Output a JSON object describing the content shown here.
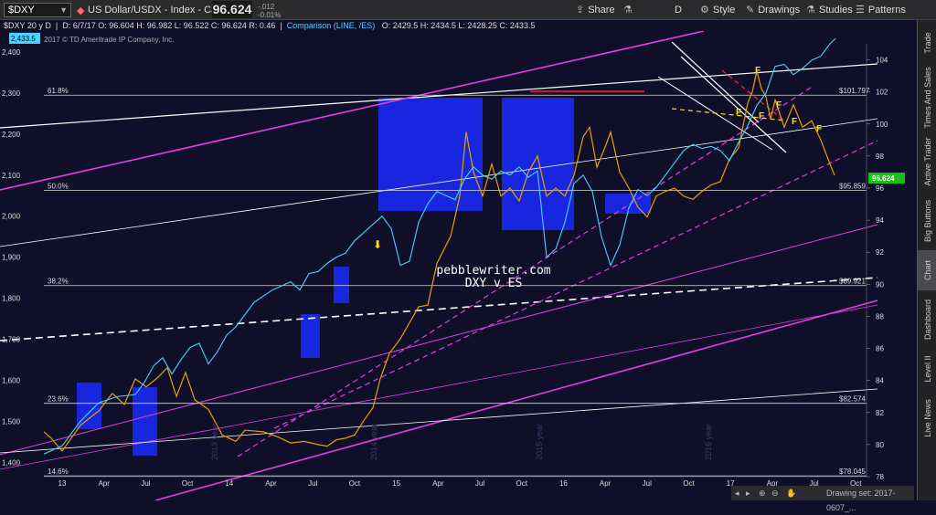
{
  "header": {
    "symbol": "$DXY",
    "description": "US Dollar/USDX - Index - Cash",
    "last_price": "96.624",
    "change": "-.012",
    "change_pct": "-0.01%",
    "buttons": [
      {
        "label": "Share",
        "icon": "share-icon"
      },
      {
        "label": "",
        "icon": "flask-icon"
      },
      {
        "label": "D",
        "icon": "period-icon"
      },
      {
        "label": "Style",
        "icon": "style-icon"
      },
      {
        "label": "Drawings",
        "icon": "pencil-icon"
      },
      {
        "label": "",
        "icon": "flask-icon"
      },
      {
        "label": "Studies",
        "icon": "flask-icon"
      },
      {
        "label": "Patterns",
        "icon": "patterns-icon"
      }
    ]
  },
  "info": {
    "title": "$DXY 20 y D",
    "ohlc": "D: 6/7/17   O: 96.604   H: 96.982   L: 96.522   C: 96.624   R: 0.46",
    "comparison": "Comparison (LINE, /ES)",
    "cmp_ohlc": "O: 2429.5   H: 2434.5   L: 2428.25   C: 2433.5",
    "copyright": "2017 © TD Ameritrade IP Company, Inc."
  },
  "side_tabs": [
    "Trade",
    "Times And Sales",
    "Active Trader",
    "Big Buttons",
    "Chart",
    "Dashboard",
    "Level II",
    "Live News"
  ],
  "active_side_tab": "Chart",
  "status": {
    "drawing_set": "Drawing set: 2017-0607_..."
  },
  "chart_data": {
    "type": "line",
    "x_ticks": [
      "13",
      "Apr",
      "Jul",
      "Oct",
      "14",
      "Apr",
      "Jul",
      "Oct",
      "15",
      "Apr",
      "Jul",
      "Oct",
      "16",
      "Apr",
      "Jul",
      "Oct",
      "17",
      "Apr",
      "Jul",
      "Oct"
    ],
    "right_axis": {
      "ticks": [
        78,
        80,
        82,
        84,
        86,
        88,
        90,
        92,
        94,
        96,
        98,
        100,
        102,
        104
      ],
      "range": [
        78,
        105
      ]
    },
    "left_axis": {
      "ticks": [
        "1,400",
        "1,500",
        "1,600",
        "1,700",
        "1,800",
        "1,900",
        "2,000",
        "2,100",
        "2,200",
        "2,300",
        "2,400"
      ],
      "range": [
        1365,
        2420
      ]
    },
    "price_label": "96.624",
    "compare_label": "2,433.5",
    "fib_levels": [
      {
        "pct": "61.8%",
        "value": "$101.797",
        "level": 101.797
      },
      {
        "pct": "50.0%",
        "value": "$95.859",
        "level": 95.859
      },
      {
        "pct": "38.2%",
        "value": "$89.921",
        "level": 89.921
      },
      {
        "pct": "23.6%",
        "value": "$82.574",
        "level": 82.574
      },
      {
        "pct": "14.6%",
        "value": "$78.045",
        "level": 78.045
      }
    ],
    "annotations": [
      "pebblewriter.com",
      "DXY v ES"
    ],
    "year_labels": [
      "2013 year",
      "2014 year",
      "2015 year",
      "2016 year"
    ],
    "F_labels": [
      "F",
      "F",
      "F",
      "F",
      "F",
      "F"
    ],
    "series": [
      {
        "name": "$DXY",
        "color": "#e8a000",
        "values": [
          [
            0,
            80.8
          ],
          [
            8,
            80.4
          ],
          [
            20,
            79.6
          ],
          [
            40,
            81.2
          ],
          [
            60,
            82.1
          ],
          [
            75,
            83.2
          ],
          [
            88,
            82.5
          ],
          [
            100,
            84.1
          ],
          [
            112,
            83.6
          ],
          [
            125,
            84.2
          ],
          [
            135,
            84.8
          ],
          [
            145,
            83.0
          ],
          [
            155,
            84.5
          ],
          [
            165,
            82.8
          ],
          [
            180,
            82.2
          ],
          [
            195,
            80.6
          ],
          [
            210,
            80.2
          ],
          [
            220,
            80.9
          ],
          [
            240,
            80.8
          ],
          [
            255,
            80.5
          ],
          [
            270,
            80.1
          ],
          [
            285,
            80.2
          ],
          [
            300,
            80.0
          ],
          [
            310,
            79.9
          ],
          [
            320,
            80.3
          ],
          [
            330,
            80.4
          ],
          [
            340,
            80.6
          ],
          [
            350,
            81.5
          ],
          [
            360,
            82.3
          ],
          [
            368,
            84.1
          ],
          [
            378,
            85.7
          ],
          [
            390,
            86.6
          ],
          [
            400,
            87.6
          ],
          [
            410,
            88.6
          ],
          [
            420,
            88.7
          ],
          [
            430,
            91.3
          ],
          [
            445,
            93.0
          ],
          [
            455,
            95.5
          ],
          [
            462,
            99.5
          ],
          [
            470,
            97.0
          ],
          [
            480,
            95.5
          ],
          [
            490,
            97.5
          ],
          [
            500,
            95.5
          ],
          [
            510,
            96.0
          ],
          [
            520,
            95.2
          ],
          [
            530,
            97.0
          ],
          [
            540,
            98.0
          ],
          [
            550,
            95.5
          ],
          [
            560,
            96.0
          ],
          [
            570,
            95.5
          ],
          [
            580,
            96.8
          ],
          [
            590,
            99.2
          ],
          [
            597,
            99.8
          ],
          [
            605,
            97.3
          ],
          [
            615,
            98.7
          ],
          [
            620,
            99.5
          ],
          [
            630,
            97.0
          ],
          [
            640,
            96.0
          ],
          [
            650,
            94.8
          ],
          [
            660,
            94.2
          ],
          [
            670,
            95.5
          ],
          [
            680,
            95.8
          ],
          [
            690,
            96.0
          ],
          [
            700,
            95.5
          ],
          [
            710,
            95.3
          ],
          [
            720,
            95.8
          ],
          [
            730,
            96.2
          ],
          [
            740,
            96.4
          ],
          [
            750,
            97.8
          ],
          [
            760,
            98.5
          ],
          [
            770,
            101.3
          ],
          [
            775,
            102.0
          ],
          [
            780,
            103.3
          ],
          [
            785,
            102.2
          ],
          [
            790,
            101.7
          ],
          [
            795,
            100.3
          ],
          [
            800,
            101.5
          ],
          [
            810,
            99.8
          ],
          [
            820,
            101.2
          ],
          [
            830,
            99.8
          ],
          [
            840,
            100.2
          ],
          [
            850,
            99.0
          ],
          [
            860,
            97.5
          ],
          [
            865,
            96.8
          ]
        ]
      },
      {
        "name": "/ES",
        "color": "#4fd0ff",
        "values": [
          [
            0,
            1420
          ],
          [
            20,
            1440
          ],
          [
            40,
            1500
          ],
          [
            60,
            1545
          ],
          [
            80,
            1560
          ],
          [
            100,
            1565
          ],
          [
            110,
            1595
          ],
          [
            120,
            1635
          ],
          [
            130,
            1655
          ],
          [
            140,
            1615
          ],
          [
            150,
            1650
          ],
          [
            160,
            1680
          ],
          [
            170,
            1690
          ],
          [
            180,
            1640
          ],
          [
            190,
            1670
          ],
          [
            200,
            1710
          ],
          [
            210,
            1730
          ],
          [
            230,
            1790
          ],
          [
            250,
            1820
          ],
          [
            270,
            1840
          ],
          [
            280,
            1820
          ],
          [
            290,
            1860
          ],
          [
            300,
            1865
          ],
          [
            310,
            1885
          ],
          [
            320,
            1900
          ],
          [
            330,
            1910
          ],
          [
            340,
            1940
          ],
          [
            350,
            1960
          ],
          [
            360,
            1980
          ],
          [
            370,
            2000
          ],
          [
            380,
            1970
          ],
          [
            390,
            1880
          ],
          [
            400,
            1890
          ],
          [
            410,
            1985
          ],
          [
            420,
            2030
          ],
          [
            430,
            2060
          ],
          [
            440,
            2050
          ],
          [
            450,
            2040
          ],
          [
            460,
            2090
          ],
          [
            470,
            2120
          ],
          [
            480,
            2100
          ],
          [
            490,
            2090
          ],
          [
            500,
            2110
          ],
          [
            510,
            2100
          ],
          [
            520,
            2120
          ],
          [
            530,
            2095
          ],
          [
            540,
            2110
          ],
          [
            550,
            1900
          ],
          [
            560,
            1920
          ],
          [
            570,
            1985
          ],
          [
            580,
            2080
          ],
          [
            590,
            2100
          ],
          [
            600,
            2060
          ],
          [
            610,
            1950
          ],
          [
            620,
            1880
          ],
          [
            630,
            1930
          ],
          [
            640,
            2020
          ],
          [
            650,
            2065
          ],
          [
            660,
            2050
          ],
          [
            670,
            2070
          ],
          [
            680,
            2100
          ],
          [
            690,
            2130
          ],
          [
            700,
            2160
          ],
          [
            710,
            2175
          ],
          [
            720,
            2165
          ],
          [
            730,
            2170
          ],
          [
            740,
            2160
          ],
          [
            750,
            2135
          ],
          [
            760,
            2180
          ],
          [
            770,
            2220
          ],
          [
            780,
            2270
          ],
          [
            790,
            2300
          ],
          [
            800,
            2365
          ],
          [
            810,
            2370
          ],
          [
            820,
            2345
          ],
          [
            830,
            2360
          ],
          [
            840,
            2380
          ],
          [
            850,
            2390
          ],
          [
            860,
            2420
          ],
          [
            866,
            2433
          ]
        ]
      }
    ]
  }
}
